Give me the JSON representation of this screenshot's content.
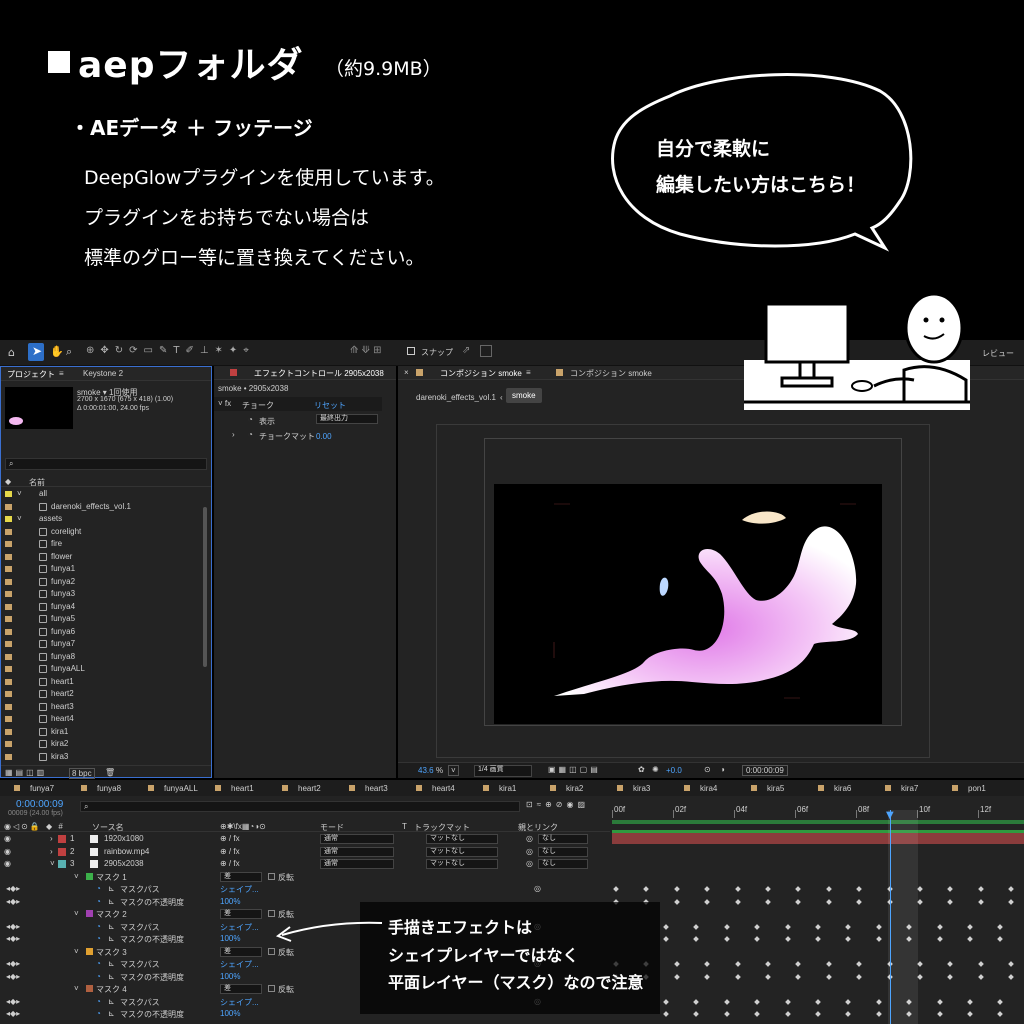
{
  "header": {
    "title": "aepフォルダ",
    "size": "（約9.9MB）",
    "bullet": "・AEデータ ＋ フッテージ",
    "desc": [
      "DeepGlowプラグインを使用しています。",
      "プラグインをお持ちでない場合は",
      "標準のグロー等に置き換えてください。"
    ],
    "bubble": [
      "自分で柔軟に",
      "編集したい方はこちら！"
    ]
  },
  "toolbar": {
    "snap": "スナップ",
    "review": "レビュー"
  },
  "project": {
    "tab1": "プロジェクト",
    "tab2": "Keystone 2",
    "name": "smoke ▾ 1回使用",
    "dims": "2700 x 1670 (675 x 418) (1.00)",
    "dur": "Δ 0:00:01:00, 24.00 fps",
    "search": "",
    "col_name": "名前",
    "items": [
      "all",
      "darenoki_effects_vol.1",
      "assets",
      "corelight",
      "fire",
      "flower",
      "funya1",
      "funya2",
      "funya3",
      "funya4",
      "funya5",
      "funya6",
      "funya7",
      "funya8",
      "funyaALL",
      "heart1",
      "heart2",
      "heart3",
      "heart4",
      "kira1",
      "kira2",
      "kira3"
    ],
    "bpc": "8 bpc"
  },
  "effects": {
    "tab": "エフェクトコントロール 2905x2038",
    "layer": "smoke • 2905x2038",
    "fx": "チョーク",
    "reset": "リセット",
    "display_label": "表示",
    "display_value": "最終出力",
    "matte_label": "チョークマット",
    "matte_value": "0.00"
  },
  "comp": {
    "tab": "コンポジション smoke",
    "tab2": "コンポジション smoke",
    "crumb1": "darenoki_effects_vol.1",
    "crumb2": "smoke",
    "zoom": "43.6",
    "quality": "1/4 画質",
    "exposure": "+0.0",
    "time": "0:00:00:09"
  },
  "timeline": {
    "tabs": [
      "funya7",
      "funya8",
      "funyaALL",
      "heart1",
      "heart2",
      "heart3",
      "heart4",
      "kira1",
      "kira2",
      "kira3",
      "kira4",
      "kira5",
      "kira6",
      "kira7",
      "pon1"
    ],
    "timecode": "0:00:00:09",
    "frames": "00009 (24.00 fps)",
    "cols": [
      "ソース名",
      "モード",
      "T",
      "トラックマット",
      "親とリンク"
    ],
    "ruler": [
      "00f",
      "02f",
      "04f",
      "06f",
      "08f",
      "10f",
      "12f"
    ],
    "layers": [
      {
        "num": "1",
        "name": "1920x1080",
        "mode": "通常",
        "matte": "マットなし",
        "parent": "なし",
        "color": "#c04040"
      },
      {
        "num": "2",
        "name": "rainbow.mp4",
        "mode": "通常",
        "matte": "マットなし",
        "parent": "なし",
        "color": "#c04040"
      },
      {
        "num": "3",
        "name": "2905x2038",
        "mode": "通常",
        "matte": "マットなし",
        "parent": "なし",
        "color": "#58b0b0"
      }
    ],
    "masks": [
      {
        "name": "マスク 1",
        "color": "#3cb04a"
      },
      {
        "name": "マスク 2",
        "color": "#a040b0"
      },
      {
        "name": "マスク 3",
        "color": "#e0a030"
      },
      {
        "name": "マスク 4",
        "color": "#b06040"
      }
    ],
    "mask_mode": "差",
    "invert": "反転",
    "path_label": "マスクパス",
    "path_value": "シェイプ...",
    "opacity_label": "マスクの不透明度",
    "opacity_value": "100%"
  },
  "note": [
    "手描きエフェクトは",
    "シェイプレイヤーではなく",
    "平面レイヤー（マスク）なので注意"
  ]
}
